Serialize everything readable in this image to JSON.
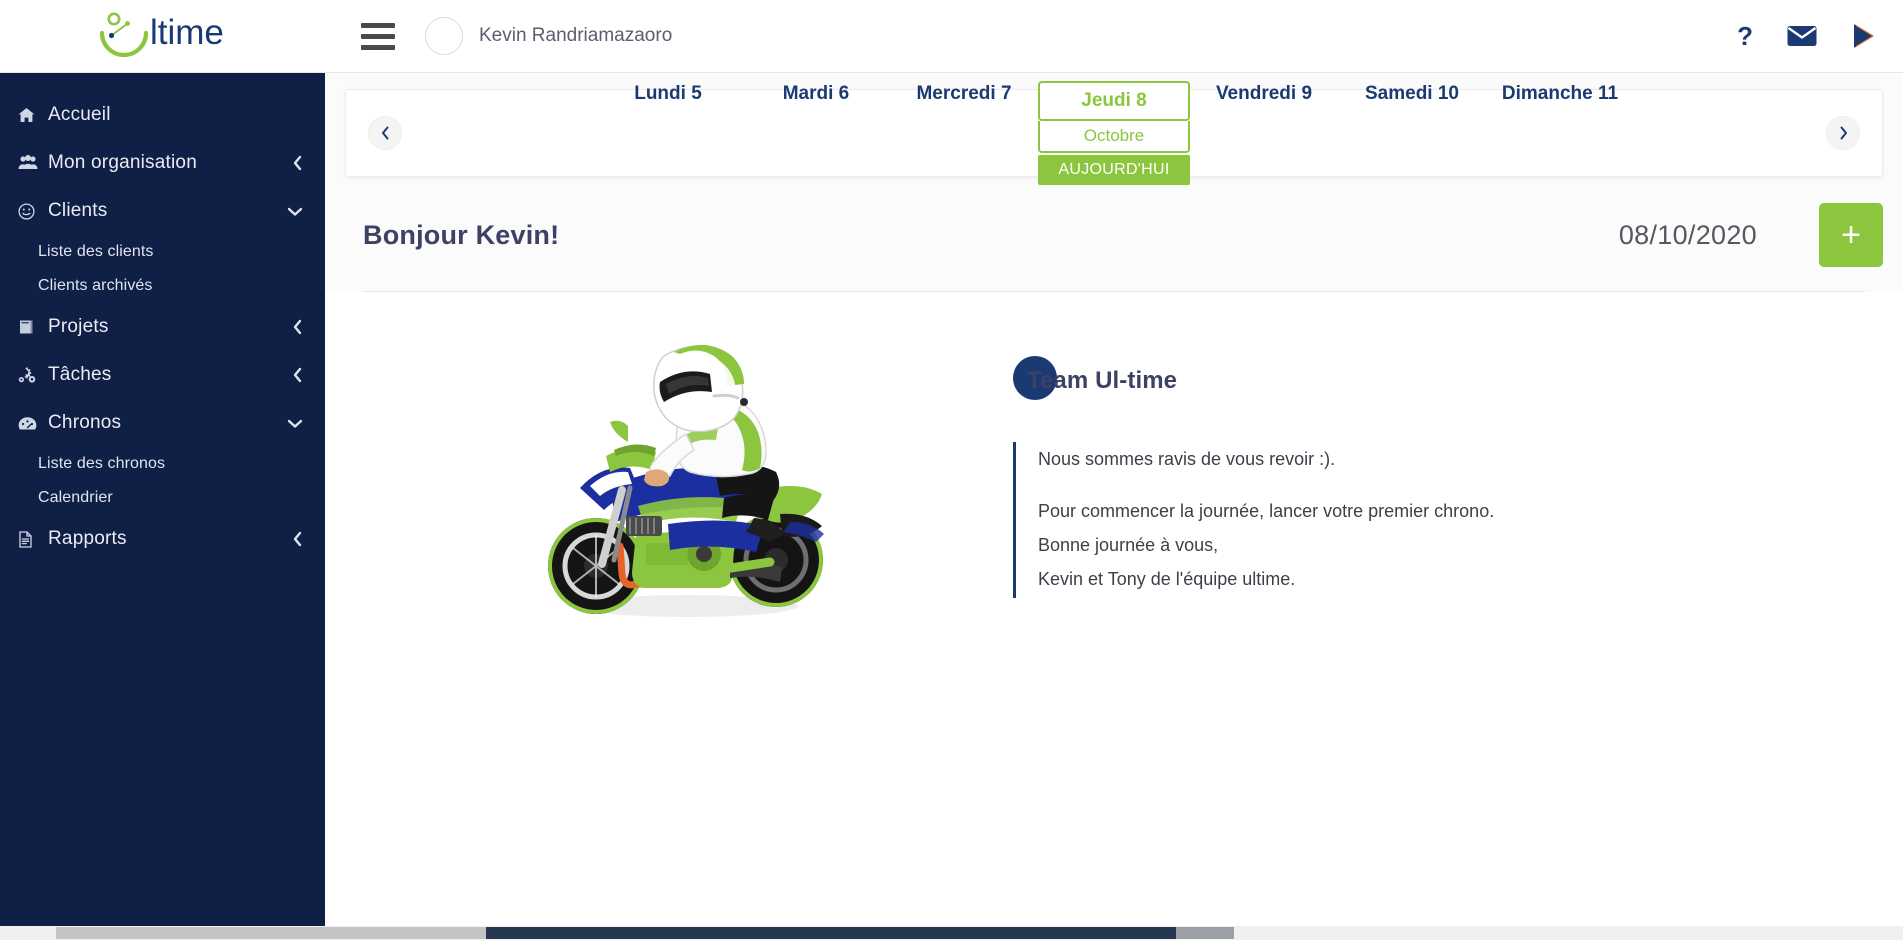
{
  "brand": {
    "name": "Ultime",
    "logo_text": "ltime",
    "accent_green": "#8cc63e",
    "accent_navy": "#1b3a73"
  },
  "sidebar": {
    "items": [
      {
        "label": "Accueil",
        "icon": "home-icon",
        "chevron": "",
        "children": []
      },
      {
        "label": "Mon organisation",
        "icon": "users-group-icon",
        "chevron": "left",
        "children": []
      },
      {
        "label": "Clients",
        "icon": "smiley-icon",
        "chevron": "down",
        "children": [
          "Liste des clients",
          "Clients archivés"
        ]
      },
      {
        "label": "Projets",
        "icon": "book-icon",
        "chevron": "left",
        "children": []
      },
      {
        "label": "Tâches",
        "icon": "gears-icon",
        "chevron": "left",
        "children": []
      },
      {
        "label": "Chronos",
        "icon": "gauge-icon",
        "chevron": "down",
        "children": [
          "Liste des chronos",
          "Calendrier"
        ]
      },
      {
        "label": "Rapports",
        "icon": "document-icon",
        "chevron": "left",
        "children": []
      }
    ]
  },
  "topbar": {
    "menu_icon": "hamburger-icon",
    "user_name": "Kevin Randriamazaoro",
    "icons": [
      {
        "name": "help-icon",
        "glyph": "?"
      },
      {
        "name": "mail-icon",
        "glyph": "envelope"
      },
      {
        "name": "send-icon",
        "glyph": "play-triangle"
      }
    ]
  },
  "datebar": {
    "prev_label": "‹",
    "next_label": "›",
    "days": [
      {
        "label": "Lundi 5",
        "selected": false
      },
      {
        "label": "Mardi 6",
        "selected": false
      },
      {
        "label": "Mercredi 7",
        "selected": false
      },
      {
        "label": "Jeudi 8",
        "selected": true,
        "month": "Octobre",
        "today_label": "AUJOURD'HUI"
      },
      {
        "label": "Vendredi 9",
        "selected": false
      },
      {
        "label": "Samedi 10",
        "selected": false
      },
      {
        "label": "Dimanche 11",
        "selected": false
      }
    ]
  },
  "greeting": {
    "title": "Bonjour Kevin!",
    "date": "08/10/2020",
    "add_label": "+"
  },
  "message": {
    "team_name": "Team Ul-time",
    "line1": "Nous sommes ravis de vous revoir :).",
    "line2": "Pour commencer la journée, lancer votre premier chrono.",
    "line3": "Bonne journée à vous,",
    "line4": "Kevin et Tony de l'équipe ultime."
  },
  "illustration": {
    "name": "motorcycle-rider-illustration"
  }
}
